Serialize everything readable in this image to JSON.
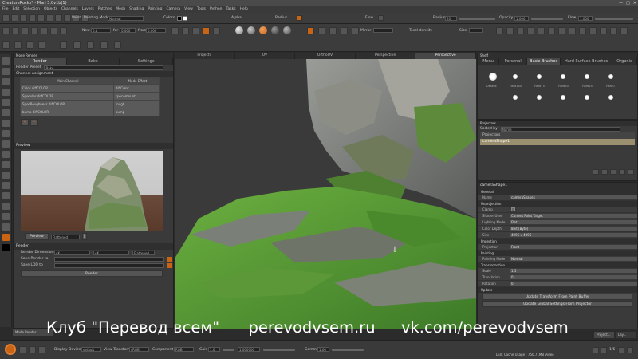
{
  "window": {
    "title": "CreatureRocks* - Mari 3.0v1b(1)",
    "controls": [
      "—",
      "□",
      "✕"
    ]
  },
  "menu": [
    "File",
    "Edit",
    "Selection",
    "Objects",
    "Channels",
    "Layers",
    "Patches",
    "Mesh",
    "Shading",
    "Painting",
    "Camera",
    "View",
    "Tools",
    "Python",
    "Tasks",
    "Help"
  ],
  "toolbar1": {
    "paint_label": "Paint",
    "painting_mode_label": "Painting Mode",
    "painting_mode_value": "Normal",
    "colors_label": "Colors",
    "alpha_label": "Alpha",
    "radius_label": "Radius",
    "flow_label": "Flow",
    "radius2_label": "Radius",
    "radius_value": "20",
    "opacity_label": "Opacity",
    "opacity_value": "1.000",
    "flow2_label": "Flow",
    "flow2_value": "1.000"
  },
  "toolbar2": {
    "new_label": "New",
    "new_value": "0.1",
    "for_label": "for",
    "for_value": "0.000",
    "from_label": "from",
    "from_value": "0.000",
    "mirror_label": "Mirror",
    "texel_label": "Texel density",
    "size_label": "Size"
  },
  "left_panel": {
    "header": "Mode Render",
    "tabs": [
      "Render",
      "Bake",
      "Settings"
    ],
    "render_preset_label": "Render Preset",
    "render_preset_value": "Bake",
    "channel_assignment_label": "Channel Assignment",
    "col_main": "Main Channel",
    "col_mode": "Mode Effect",
    "channels": [
      {
        "main": "Color diffCOLOR",
        "mode": "diffColor"
      },
      {
        "main": "Specular diffCOLOR",
        "mode": "specAmount"
      },
      {
        "main": "SpecRoughness diffCOLOR",
        "mode": "rough"
      },
      {
        "main": "bump diffCOLOR",
        "mode": "bump"
      }
    ],
    "add_btn": "+",
    "remove_btn": "−",
    "preview_label": "Preview",
    "preview_btn": "Preview",
    "preview_mode": "Flattened",
    "render_label": "Render",
    "render_dims_label": "Render Dimensions",
    "render_dims_w": "4K",
    "render_dims_h": "4K",
    "render_dims_mode": "Flattened",
    "save_render_label": "Save Render to",
    "save_lod_label": "Save LOD to",
    "render_button": "Render",
    "bottom_tab": "Mode Render"
  },
  "viewport": {
    "tabs": [
      "Projects",
      "UV",
      "OrthoUV",
      "Perspective",
      "Perspective"
    ],
    "active_tab": 4
  },
  "shelf": {
    "title": "Shelf",
    "tabs": [
      "Menu",
      "Personal",
      "Basic Brushes",
      "Hard Surface Brushes",
      "Organic"
    ],
    "brushes": [
      "Default",
      "Hard100",
      "Hard75",
      "Hard50",
      "Hard25",
      "Hard0"
    ]
  },
  "projectors": {
    "title": "Projectors",
    "sorted_by_label": "Sorted by",
    "sorted_by_value": "Name",
    "group": "Projectors",
    "item": "cameraShape1"
  },
  "properties": {
    "header": "cameraShape1",
    "general_label": "General",
    "name_key": "Name",
    "name_value": "cameraShape1",
    "unprojection_label": "Unprojection",
    "clamp_key": "Clamp",
    "shader_used_key": "Shader Used",
    "shader_used_value": "Current Paint Target",
    "lighting_mode_key": "Lighting Mode",
    "lighting_mode_value": "Flat",
    "color_depth_key": "Color Depth",
    "color_depth_value": "8bit (Byte)",
    "size_key": "Size",
    "size_value": "4096 x 4096",
    "projection_label": "Projection",
    "projection_key": "Projection",
    "projection_value": "Front",
    "painting_label": "Painting",
    "painting_mode_key": "Painting Mode",
    "painting_mode_value": "Normal",
    "transformation_label": "Transformation",
    "scale_key": "Scale",
    "scale_value": "1.5",
    "translation_key": "Translation",
    "translation_value": "0",
    "rotation_key": "Rotation",
    "rotation_value": "0",
    "update_label": "Update",
    "update_btn1": "Update Transform From Paint Buffer",
    "update_btn2": "Update Global Settings From Projector",
    "bottom_tabs": [
      "Project...",
      "Lay..."
    ]
  },
  "bottom": {
    "display_device_label": "Display Device",
    "display_device_value": "default",
    "view_transform_label": "View Transform",
    "view_transform_value": "sRGB",
    "component_label": "Component",
    "component_value": "RGB",
    "gain_label": "Gain",
    "gain_value": "1.0",
    "gain_slider_value": "1.000000",
    "gamma_label": "Gamma",
    "gamma_value": "1.00",
    "disk_cache": "Disk Cache Usage : 750.71MB Video",
    "count_value": "1/6"
  },
  "watermark": {
    "club": "Клуб \"Перевод всем\"",
    "site": "perevodvsem.ru",
    "vk": "vk.com/perevodvsem"
  },
  "colors": {
    "accent": "#c86414",
    "grass": "#5ea83a",
    "rock": "#8a8c8a",
    "panel": "#3a3a3a"
  }
}
